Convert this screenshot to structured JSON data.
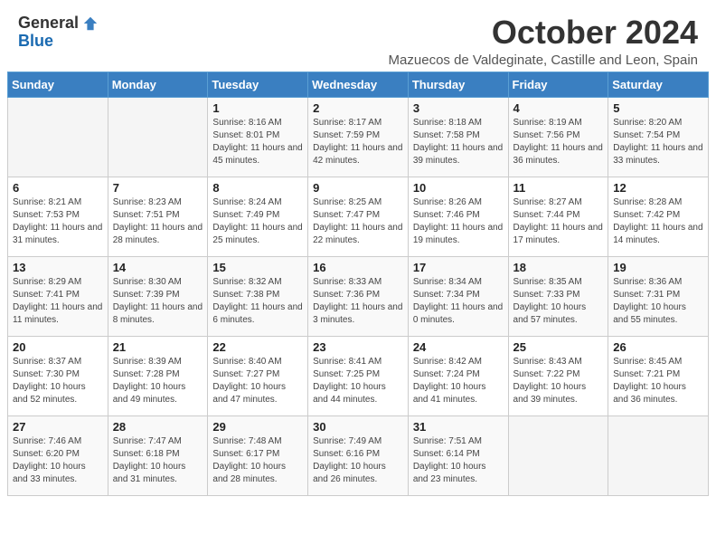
{
  "header": {
    "logo_general": "General",
    "logo_blue": "Blue",
    "month_title": "October 2024",
    "subtitle": "Mazuecos de Valdeginate, Castille and Leon, Spain"
  },
  "weekdays": [
    "Sunday",
    "Monday",
    "Tuesday",
    "Wednesday",
    "Thursday",
    "Friday",
    "Saturday"
  ],
  "weeks": [
    [
      {
        "day": "",
        "sunrise": "",
        "sunset": "",
        "daylight": ""
      },
      {
        "day": "",
        "sunrise": "",
        "sunset": "",
        "daylight": ""
      },
      {
        "day": "1",
        "sunrise": "Sunrise: 8:16 AM",
        "sunset": "Sunset: 8:01 PM",
        "daylight": "Daylight: 11 hours and 45 minutes."
      },
      {
        "day": "2",
        "sunrise": "Sunrise: 8:17 AM",
        "sunset": "Sunset: 7:59 PM",
        "daylight": "Daylight: 11 hours and 42 minutes."
      },
      {
        "day": "3",
        "sunrise": "Sunrise: 8:18 AM",
        "sunset": "Sunset: 7:58 PM",
        "daylight": "Daylight: 11 hours and 39 minutes."
      },
      {
        "day": "4",
        "sunrise": "Sunrise: 8:19 AM",
        "sunset": "Sunset: 7:56 PM",
        "daylight": "Daylight: 11 hours and 36 minutes."
      },
      {
        "day": "5",
        "sunrise": "Sunrise: 8:20 AM",
        "sunset": "Sunset: 7:54 PM",
        "daylight": "Daylight: 11 hours and 33 minutes."
      }
    ],
    [
      {
        "day": "6",
        "sunrise": "Sunrise: 8:21 AM",
        "sunset": "Sunset: 7:53 PM",
        "daylight": "Daylight: 11 hours and 31 minutes."
      },
      {
        "day": "7",
        "sunrise": "Sunrise: 8:23 AM",
        "sunset": "Sunset: 7:51 PM",
        "daylight": "Daylight: 11 hours and 28 minutes."
      },
      {
        "day": "8",
        "sunrise": "Sunrise: 8:24 AM",
        "sunset": "Sunset: 7:49 PM",
        "daylight": "Daylight: 11 hours and 25 minutes."
      },
      {
        "day": "9",
        "sunrise": "Sunrise: 8:25 AM",
        "sunset": "Sunset: 7:47 PM",
        "daylight": "Daylight: 11 hours and 22 minutes."
      },
      {
        "day": "10",
        "sunrise": "Sunrise: 8:26 AM",
        "sunset": "Sunset: 7:46 PM",
        "daylight": "Daylight: 11 hours and 19 minutes."
      },
      {
        "day": "11",
        "sunrise": "Sunrise: 8:27 AM",
        "sunset": "Sunset: 7:44 PM",
        "daylight": "Daylight: 11 hours and 17 minutes."
      },
      {
        "day": "12",
        "sunrise": "Sunrise: 8:28 AM",
        "sunset": "Sunset: 7:42 PM",
        "daylight": "Daylight: 11 hours and 14 minutes."
      }
    ],
    [
      {
        "day": "13",
        "sunrise": "Sunrise: 8:29 AM",
        "sunset": "Sunset: 7:41 PM",
        "daylight": "Daylight: 11 hours and 11 minutes."
      },
      {
        "day": "14",
        "sunrise": "Sunrise: 8:30 AM",
        "sunset": "Sunset: 7:39 PM",
        "daylight": "Daylight: 11 hours and 8 minutes."
      },
      {
        "day": "15",
        "sunrise": "Sunrise: 8:32 AM",
        "sunset": "Sunset: 7:38 PM",
        "daylight": "Daylight: 11 hours and 6 minutes."
      },
      {
        "day": "16",
        "sunrise": "Sunrise: 8:33 AM",
        "sunset": "Sunset: 7:36 PM",
        "daylight": "Daylight: 11 hours and 3 minutes."
      },
      {
        "day": "17",
        "sunrise": "Sunrise: 8:34 AM",
        "sunset": "Sunset: 7:34 PM",
        "daylight": "Daylight: 11 hours and 0 minutes."
      },
      {
        "day": "18",
        "sunrise": "Sunrise: 8:35 AM",
        "sunset": "Sunset: 7:33 PM",
        "daylight": "Daylight: 10 hours and 57 minutes."
      },
      {
        "day": "19",
        "sunrise": "Sunrise: 8:36 AM",
        "sunset": "Sunset: 7:31 PM",
        "daylight": "Daylight: 10 hours and 55 minutes."
      }
    ],
    [
      {
        "day": "20",
        "sunrise": "Sunrise: 8:37 AM",
        "sunset": "Sunset: 7:30 PM",
        "daylight": "Daylight: 10 hours and 52 minutes."
      },
      {
        "day": "21",
        "sunrise": "Sunrise: 8:39 AM",
        "sunset": "Sunset: 7:28 PM",
        "daylight": "Daylight: 10 hours and 49 minutes."
      },
      {
        "day": "22",
        "sunrise": "Sunrise: 8:40 AM",
        "sunset": "Sunset: 7:27 PM",
        "daylight": "Daylight: 10 hours and 47 minutes."
      },
      {
        "day": "23",
        "sunrise": "Sunrise: 8:41 AM",
        "sunset": "Sunset: 7:25 PM",
        "daylight": "Daylight: 10 hours and 44 minutes."
      },
      {
        "day": "24",
        "sunrise": "Sunrise: 8:42 AM",
        "sunset": "Sunset: 7:24 PM",
        "daylight": "Daylight: 10 hours and 41 minutes."
      },
      {
        "day": "25",
        "sunrise": "Sunrise: 8:43 AM",
        "sunset": "Sunset: 7:22 PM",
        "daylight": "Daylight: 10 hours and 39 minutes."
      },
      {
        "day": "26",
        "sunrise": "Sunrise: 8:45 AM",
        "sunset": "Sunset: 7:21 PM",
        "daylight": "Daylight: 10 hours and 36 minutes."
      }
    ],
    [
      {
        "day": "27",
        "sunrise": "Sunrise: 7:46 AM",
        "sunset": "Sunset: 6:20 PM",
        "daylight": "Daylight: 10 hours and 33 minutes."
      },
      {
        "day": "28",
        "sunrise": "Sunrise: 7:47 AM",
        "sunset": "Sunset: 6:18 PM",
        "daylight": "Daylight: 10 hours and 31 minutes."
      },
      {
        "day": "29",
        "sunrise": "Sunrise: 7:48 AM",
        "sunset": "Sunset: 6:17 PM",
        "daylight": "Daylight: 10 hours and 28 minutes."
      },
      {
        "day": "30",
        "sunrise": "Sunrise: 7:49 AM",
        "sunset": "Sunset: 6:16 PM",
        "daylight": "Daylight: 10 hours and 26 minutes."
      },
      {
        "day": "31",
        "sunrise": "Sunrise: 7:51 AM",
        "sunset": "Sunset: 6:14 PM",
        "daylight": "Daylight: 10 hours and 23 minutes."
      },
      {
        "day": "",
        "sunrise": "",
        "sunset": "",
        "daylight": ""
      },
      {
        "day": "",
        "sunrise": "",
        "sunset": "",
        "daylight": ""
      }
    ]
  ]
}
